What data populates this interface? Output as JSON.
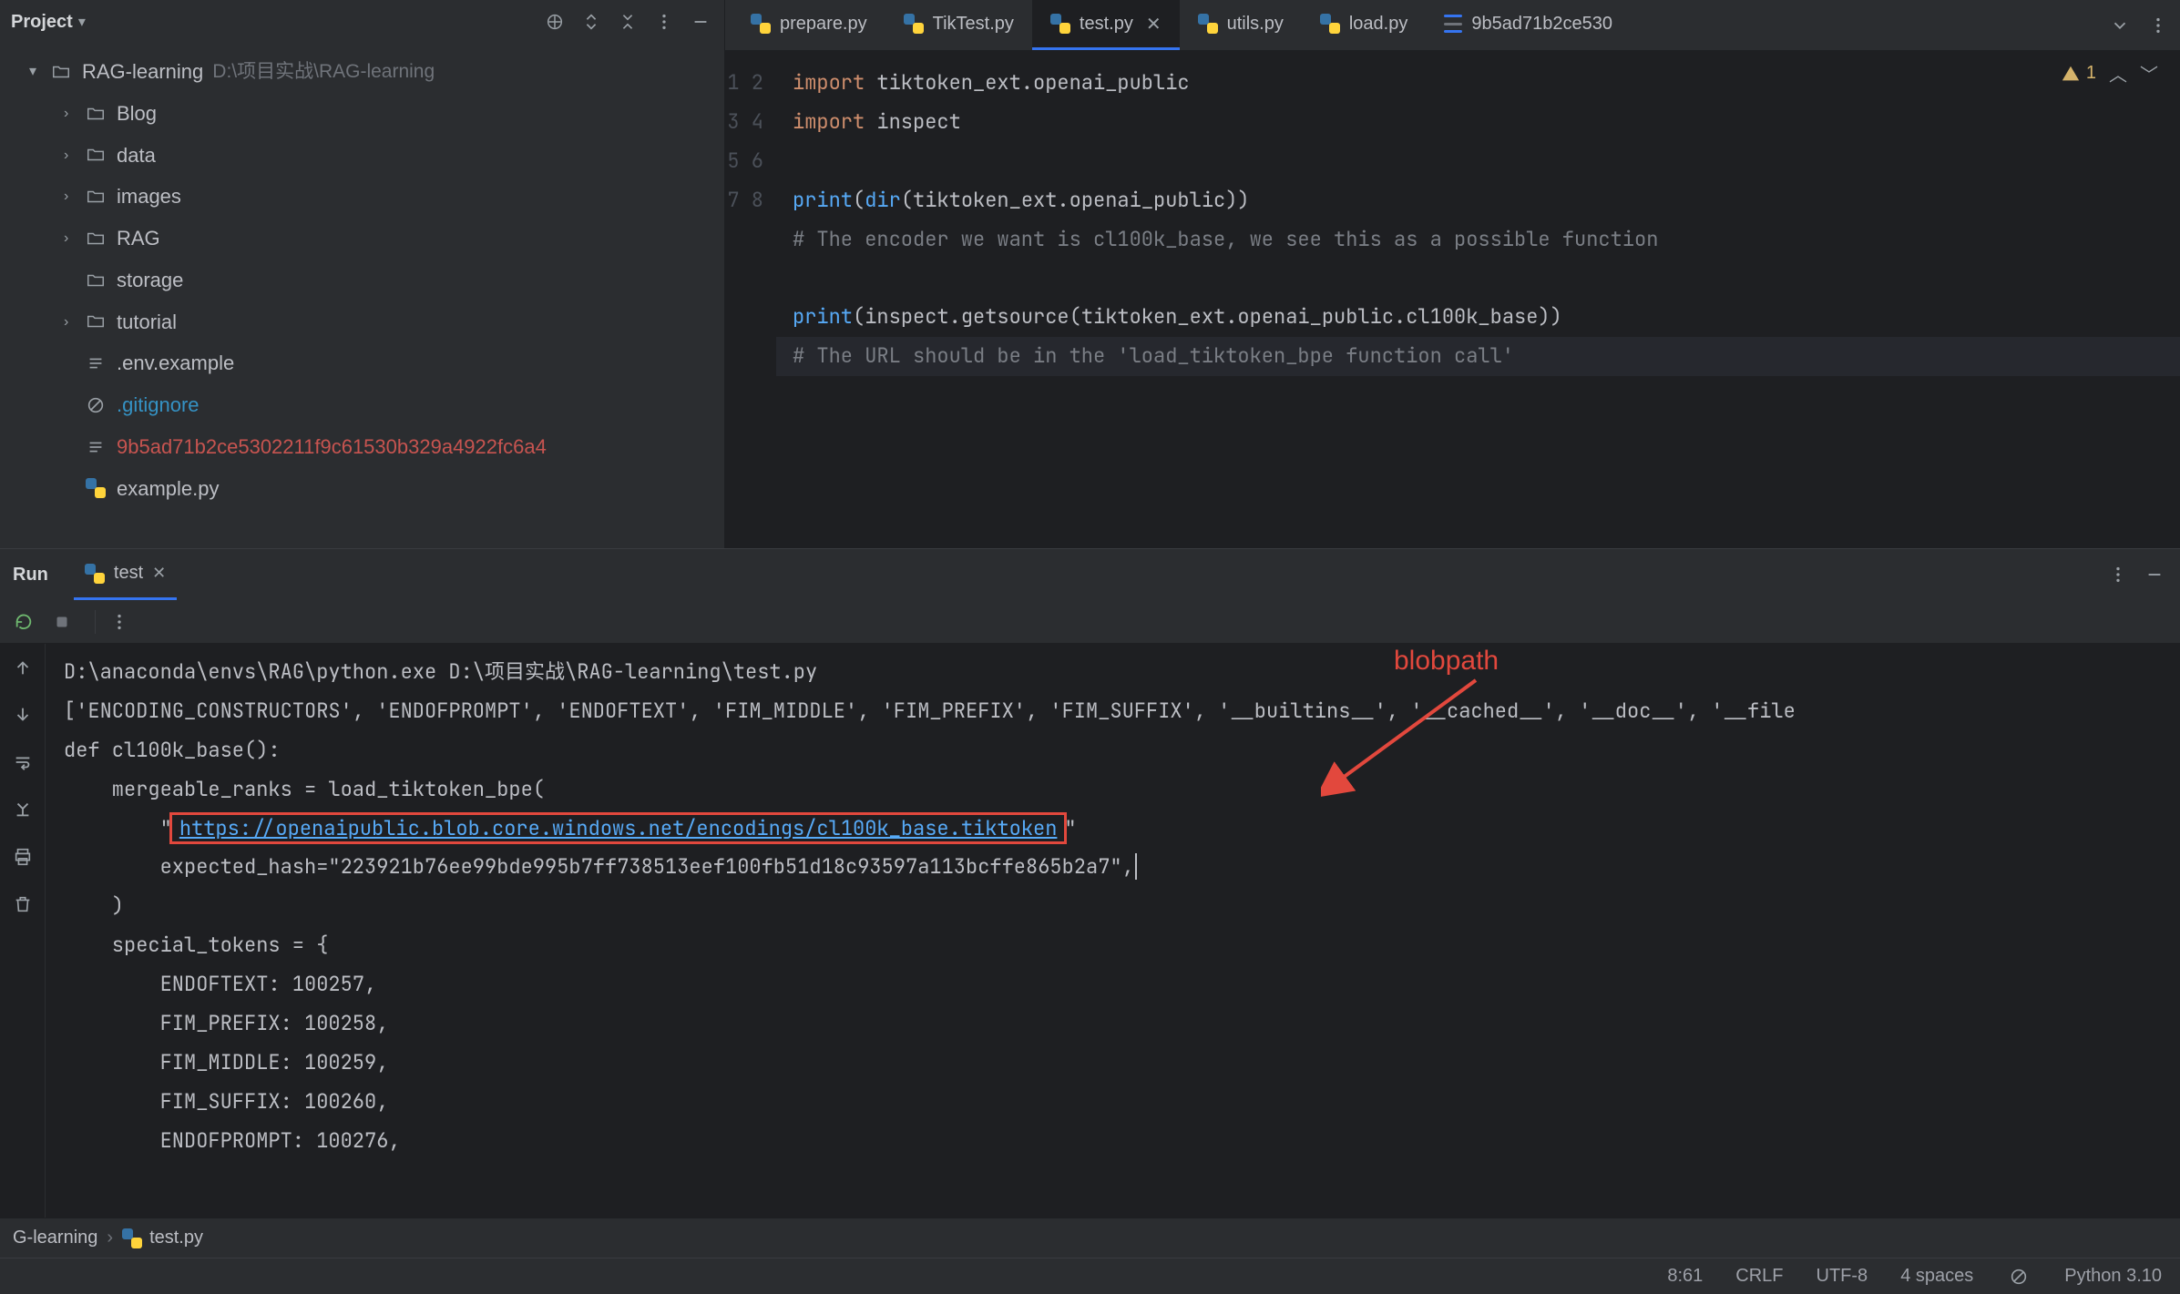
{
  "project_panel": {
    "title": "Project",
    "root": {
      "name": "RAG-learning",
      "path": "D:\\项目实战\\RAG-learning"
    },
    "folders": [
      "Blog",
      "data",
      "images",
      "RAG",
      "storage",
      "tutorial"
    ],
    "files": {
      "env": ".env.example",
      "gitignore": ".gitignore",
      "hash": "9b5ad71b2ce5302211f9c61530b329a4922fc6a4",
      "example": "example.py"
    }
  },
  "tabs": {
    "items": [
      "prepare.py",
      "TikTest.py",
      "test.py",
      "utils.py",
      "load.py"
    ],
    "diff": "9b5ad71b2ce530"
  },
  "inspection": {
    "count": "1"
  },
  "code": {
    "gutter": [
      "1",
      "2",
      "3",
      "4",
      "5",
      "6",
      "7",
      "8"
    ],
    "l1a": "import",
    "l1b": " tiktoken_ext.openai_public",
    "l2a": "import",
    "l2b": " inspect",
    "l3": "",
    "l4a": "print",
    "l4b": "(",
    "l4c": "dir",
    "l4d": "(tiktoken_ext.openai_public))",
    "l5": "# The encoder we want is cl100k_base, we see this as a possible function",
    "l6": "",
    "l7a": "print",
    "l7b": "(inspect.getsource(tiktoken_ext.openai_public.cl100k_base))",
    "l8": "# The URL should be in the 'load_tiktoken_bpe function call'"
  },
  "run": {
    "label": "Run",
    "tab": "test",
    "console": {
      "l1": "D:\\anaconda\\envs\\RAG\\python.exe D:\\项目实战\\RAG-learning\\test.py",
      "l2": "['ENCODING_CONSTRUCTORS', 'ENDOFPROMPT', 'ENDOFTEXT', 'FIM_MIDDLE', 'FIM_PREFIX', 'FIM_SUFFIX', '__builtins__', '__cached__', '__doc__', '__file",
      "l3": "def cl100k_base():",
      "l4": "    mergeable_ranks = load_tiktoken_bpe(",
      "l5a": "        \"",
      "url": "https://openaipublic.blob.core.windows.net/encodings/cl100k_base.tiktoken",
      "l5b": "\"",
      "l6": "        expected_hash=\"223921b76ee99bde995b7ff738513eef100fb51d18c93597a113bcffe865b2a7\",",
      "l7": "    )",
      "l8": "    special_tokens = {",
      "l9": "        ENDOFTEXT: 100257,",
      "l10": "        FIM_PREFIX: 100258,",
      "l11": "        FIM_MIDDLE: 100259,",
      "l12": "        FIM_SUFFIX: 100260,",
      "l13": "        ENDOFPROMPT: 100276,"
    },
    "annotation": "blobpath"
  },
  "crumbs": {
    "a": "G-learning",
    "b": "test.py"
  },
  "status": {
    "pos": "8:61",
    "sep": "CRLF",
    "enc": "UTF-8",
    "indent": "4 spaces",
    "interp": "Python 3.10"
  }
}
